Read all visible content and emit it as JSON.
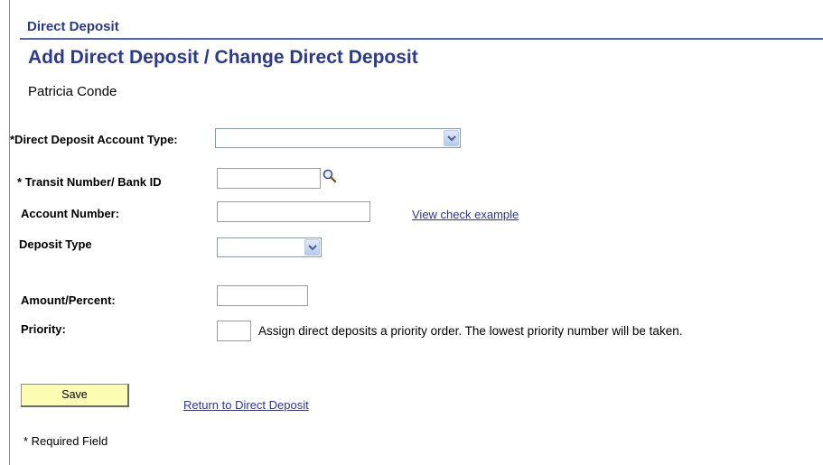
{
  "section_title": "Direct Deposit",
  "page_title": "Add Direct Deposit / Change Direct Deposit",
  "person_name": "Patricia Conde",
  "fields": {
    "account_type": {
      "label": "*Direct Deposit Account Type:",
      "value": ""
    },
    "transit_number": {
      "label": "* Transit Number/ Bank ID",
      "value": ""
    },
    "account_number": {
      "label": "Account Number:",
      "value": ""
    },
    "deposit_type": {
      "label": "Deposit Type",
      "value": ""
    },
    "amount_percent": {
      "label": "Amount/Percent:",
      "value": ""
    },
    "priority": {
      "label": "Priority:",
      "value": "",
      "help": "Assign direct deposits a priority order. The lowest priority number will be taken."
    }
  },
  "links": {
    "view_check_example": "View check example",
    "return_to_direct_deposit": "Return to Direct Deposit"
  },
  "buttons": {
    "save": "Save"
  },
  "footer": {
    "required_note": "* Required Field"
  },
  "icons": {
    "lookup": "magnifier-icon",
    "dropdown": "chevron-down-icon"
  },
  "colors": {
    "title": "#2a3a8c",
    "rule": "#4f66a6",
    "link": "#2b32b0",
    "save_button": "#fcfcb2"
  }
}
